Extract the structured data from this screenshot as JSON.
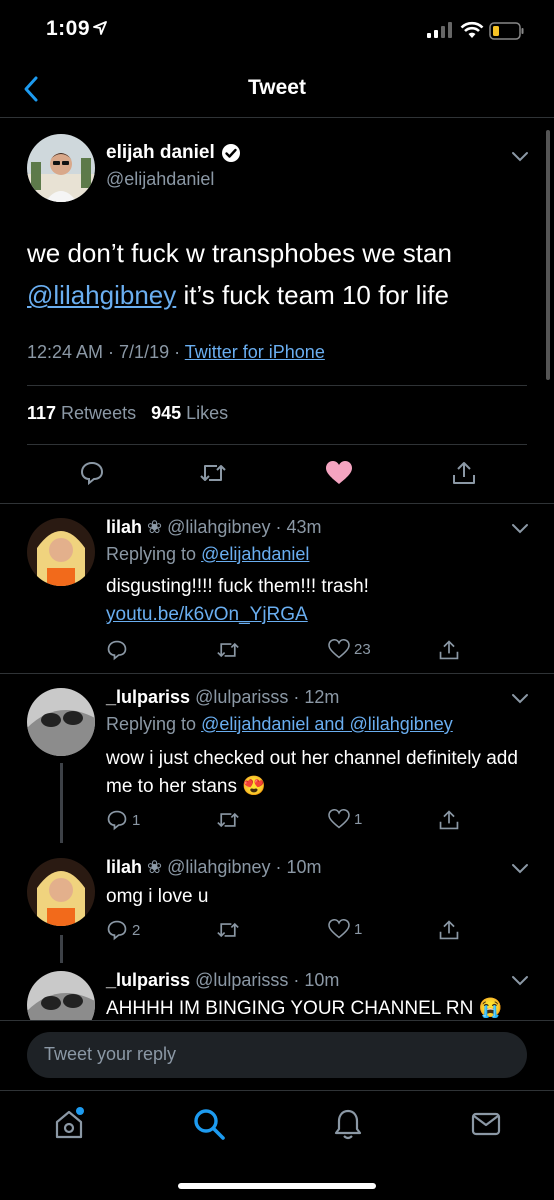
{
  "status": {
    "time": "1:09"
  },
  "nav": {
    "title": "Tweet"
  },
  "main": {
    "name": "elijah daniel",
    "handle": "@elijahdaniel",
    "text_part1": "we don’t fuck w transphobes we stan",
    "mention": "@lilahgibney",
    "text_part2": " it’s fuck team 10 for life",
    "time_date": "12:24 AM · 7/1/19 · ",
    "source": "Twitter for iPhone",
    "retweets": "117",
    "retweets_label": " Retweets",
    "likes": "945",
    "likes_label": " Likes",
    "liked_color": "#f4a4c0"
  },
  "replies": [
    {
      "name": "lilah",
      "badge": "❀",
      "handle": "@lilahgibney",
      "time": "· 43m",
      "replying_prefix": "Replying to ",
      "replying_to": "@elijahdaniel",
      "text": "disgusting!!!! fuck them!!! trash! ",
      "link": "youtu.be/k6vOn_YjRGA",
      "comments": "",
      "likes": "23"
    },
    {
      "name": "_lulpariss",
      "handle": "@lulparisss",
      "time": "· 12m",
      "replying_prefix": "Replying to ",
      "replying_to": "@elijahdaniel and @lilahgibney",
      "text": "wow i just checked out her channel definitely add me to her stans 😍",
      "comments": "1",
      "likes": "1"
    },
    {
      "name": "lilah",
      "badge": "❀",
      "handle": "@lilahgibney",
      "time": "· 10m",
      "text": "omg i love u",
      "comments": "2",
      "likes": "1"
    },
    {
      "name": "_lulpariss",
      "handle": "@lulparisss",
      "time": "· 10m",
      "text": "AHHHH IM BINGING YOUR CHANNEL RN 😭"
    }
  ],
  "compose": {
    "placeholder": "Tweet your reply"
  },
  "icons": {
    "back": "chevron-left-icon",
    "reply": "comment-icon",
    "retweet": "retweet-icon",
    "like": "heart-icon",
    "share": "share-icon",
    "home": "home-icon",
    "search": "search-icon",
    "notifications": "bell-icon",
    "messages": "mail-icon"
  },
  "colors": {
    "accent": "#1d9bf0",
    "link": "#6aaef0",
    "muted": "#8b98a5",
    "background": "#000000"
  }
}
